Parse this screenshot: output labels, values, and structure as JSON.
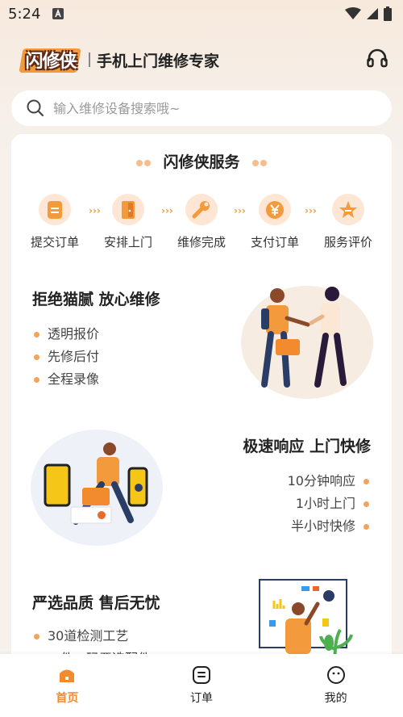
{
  "status_bar": {
    "time": "5:24"
  },
  "header": {
    "logo_text": "闪修侠",
    "slogan": "手机上门维修专家"
  },
  "search": {
    "placeholder": "输入维修设备搜索哦~"
  },
  "service": {
    "title": "闪修侠服务",
    "steps": [
      {
        "label": "提交订单",
        "icon": "document-icon"
      },
      {
        "label": "安排上门",
        "icon": "door-icon"
      },
      {
        "label": "维修完成",
        "icon": "wrench-icon"
      },
      {
        "label": "支付订单",
        "icon": "yuan-icon"
      },
      {
        "label": "服务评价",
        "icon": "star-icon"
      }
    ]
  },
  "features": [
    {
      "title": "拒绝猫腻 放心维修",
      "items": [
        "透明报价",
        "先修后付",
        "全程录像"
      ]
    },
    {
      "title": "极速响应 上门快修",
      "items": [
        "10分钟响应",
        "1小时上门",
        "半小时快修"
      ]
    },
    {
      "title": "严选品质 售后无忧",
      "items": [
        "30道检测工艺",
        "一件一码严选配件"
      ]
    }
  ],
  "nav": [
    {
      "label": "首页",
      "icon": "home-icon",
      "active": true
    },
    {
      "label": "订单",
      "icon": "order-icon",
      "active": false
    },
    {
      "label": "我的",
      "icon": "profile-icon",
      "active": false
    }
  ],
  "colors": {
    "accent": "#f39a3c",
    "active_nav": "#f28a2e",
    "background": "#f6f1ec"
  }
}
